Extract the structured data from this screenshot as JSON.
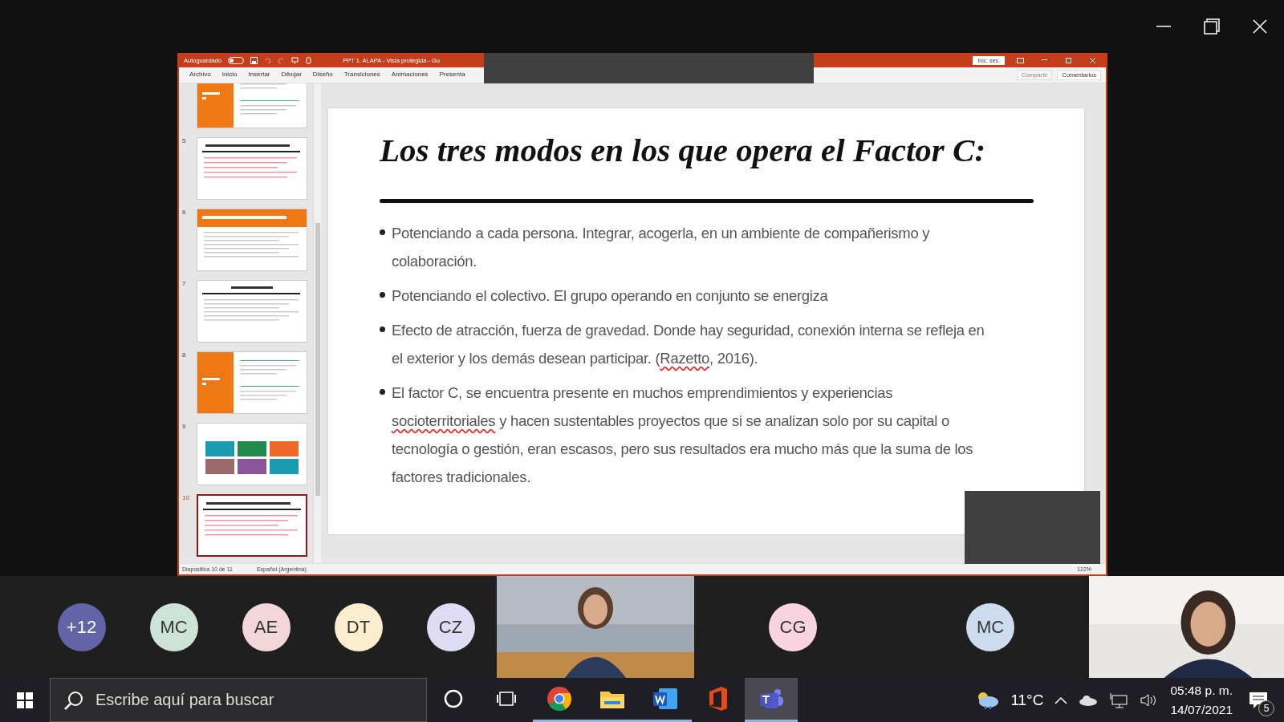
{
  "powerpoint": {
    "autosave_label": "Autoguardado",
    "autosave_on": false,
    "title": "PPT 1. ALAPA  -  Vista protegida  -  Gu",
    "signin": "Inic. ses.",
    "ribbon_tabs": [
      {
        "label": "Archivo",
        "selected": false
      },
      {
        "label": "Inicio",
        "selected": false
      },
      {
        "label": "Insertar",
        "selected": false
      },
      {
        "label": "Dibujar",
        "selected": false
      },
      {
        "label": "Diseño",
        "selected": false
      },
      {
        "label": "Transiciones",
        "selected": false
      },
      {
        "label": "Animaciones",
        "selected": false
      },
      {
        "label": "Presenta",
        "selected": false
      }
    ],
    "share": {
      "label": "Compartir",
      "disabled": true
    },
    "comments": "Comentarios",
    "thumbnails": [
      {
        "kind": "orange-left",
        "selected": false
      },
      {
        "number": "5",
        "kind": "title-bullets",
        "selected": false
      },
      {
        "number": "6",
        "kind": "orange-banner",
        "selected": false
      },
      {
        "number": "7",
        "kind": "title-text",
        "selected": false
      },
      {
        "number": "8",
        "kind": "orange-left",
        "selected": false
      },
      {
        "number": "9",
        "kind": "boxes",
        "selected": false
      },
      {
        "number": "10",
        "kind": "title-bullets",
        "selected": true
      }
    ],
    "slide": {
      "title": "Los tres modos en los que opera el Factor C:",
      "bullets": [
        {
          "segments": [
            {
              "text": "Potenciando a cada persona. Integrar, acogerla, en un ambiente de compañerismo y colaboración.",
              "flagged": false
            }
          ]
        },
        {
          "segments": [
            {
              "text": "Potenciando el colectivo. El grupo operando en conjunto se energiza",
              "flagged": false
            }
          ]
        },
        {
          "segments": [
            {
              "text": "Efecto de atracción, fuerza de gravedad. Donde hay seguridad, conexión interna se refleja en el exterior y los demás desean participar. (",
              "flagged": false
            },
            {
              "text": "Razetto",
              "flagged": true
            },
            {
              "text": ", 2016).",
              "flagged": false
            }
          ]
        },
        {
          "segments": [
            {
              "text": "El factor C, se encuentra presente en muchos emprendimientos y experiencias ",
              "flagged": false
            },
            {
              "text": "socioterritoriales",
              "flagged": true
            },
            {
              "text": " y hacen  sustentables proyectos que si se analizan solo por su capital o tecnología o gestión, eran escasos, pero sus resultados era mucho más que la suma de los factores tradicionales.",
              "flagged": false
            }
          ]
        }
      ]
    },
    "status": {
      "slide_count": "Diapositiva 10 de 11",
      "language": "Español (Argentina)",
      "zoom": "122%"
    }
  },
  "participants": [
    {
      "kind": "avatar",
      "initials": "+12",
      "color": "#6264a7"
    },
    {
      "kind": "avatar",
      "initials": "MC",
      "color": "#cde3d6"
    },
    {
      "kind": "avatar",
      "initials": "AE",
      "color": "#f2d6d9"
    },
    {
      "kind": "avatar",
      "initials": "DT",
      "color": "#fbedce"
    },
    {
      "kind": "avatar",
      "initials": "CZ",
      "color": "#dedcf2"
    },
    {
      "kind": "video"
    },
    {
      "kind": "avatar",
      "initials": "CG",
      "color": "#f7d4e0"
    },
    {
      "kind": "avatar",
      "initials": "MC",
      "color": "#cddcee"
    },
    {
      "kind": "video"
    }
  ],
  "taskbar": {
    "search_placeholder": "Escribe aquí para buscar",
    "apps": [
      {
        "kind": "cortana",
        "running": false,
        "selected": false
      },
      {
        "kind": "taskview",
        "running": false,
        "selected": false
      },
      {
        "kind": "chrome",
        "running": true,
        "selected": false
      },
      {
        "kind": "explorer",
        "running": true,
        "selected": false
      },
      {
        "kind": "word",
        "running": true,
        "selected": false
      },
      {
        "kind": "office",
        "running": false,
        "selected": false
      },
      {
        "kind": "teams",
        "running": true,
        "selected": true
      }
    ],
    "temperature": "11°C",
    "time": "05:48 p. m.",
    "date": "14/07/2021",
    "notifications": "5"
  }
}
